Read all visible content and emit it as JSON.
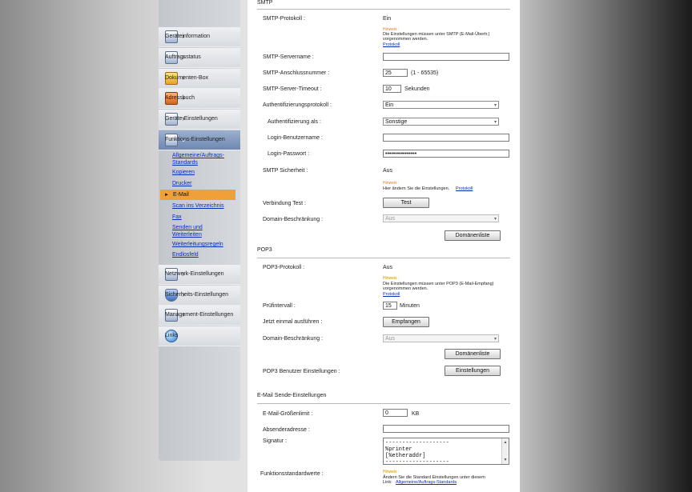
{
  "sidebar": {
    "items": [
      {
        "label": "Geräteinformation",
        "icon": "device-info-icon"
      },
      {
        "label": "Auftragsstatus",
        "icon": "job-status-icon"
      },
      {
        "label": "Dokumenten-Box",
        "icon": "document-box-icon"
      },
      {
        "label": "Adressbuch",
        "icon": "address-book-icon"
      },
      {
        "label": "Geräte-Einstellungen",
        "icon": "device-settings-icon"
      },
      {
        "label": "Funktions-Einstellungen",
        "icon": "function-settings-icon"
      },
      {
        "label": "Netzwerk-Einstellungen",
        "icon": "network-settings-icon"
      },
      {
        "label": "Sicherheits-Einstellungen",
        "icon": "shield-icon"
      },
      {
        "label": "Management-Einstellungen",
        "icon": "management-settings-icon"
      },
      {
        "label": "Links",
        "icon": "globe-icon"
      }
    ],
    "submenu": [
      "Allgemeine/Auftrags-Standards",
      "Kopieren",
      "Drucker",
      "E-Mail",
      "Scan ins Verzeichnis",
      "Fax",
      "Senden und Weiterleiten",
      "Weiterleitungsregeln",
      "Endlosfeld"
    ]
  },
  "smtp": {
    "title": "SMTP",
    "protocol_label": "SMTP-Protokoll :",
    "protocol_value": "Ein",
    "hint_title": "Hinweis :",
    "hint_text": "Die Einstellungen müssen unter SMTP (E-Mail-Übertr.) vorgenommen werden.",
    "hint_link": "Protokoll",
    "server_label": "SMTP-Servername :",
    "server_value": "",
    "port_label": "SMTP-Anschlussnummer :",
    "port_value": "25",
    "port_range": "(1 - 65535)",
    "timeout_label": "SMTP-Server-Timeout :",
    "timeout_value": "10",
    "timeout_unit": "Sekunden",
    "auth_protocol_label": "Authentifizierungsprotokoll :",
    "auth_protocol_value": "Ein",
    "auth_as_label": "Authentifizierung als :",
    "auth_as_value": "Sonstige",
    "login_user_label": "Login-Benutzername :",
    "login_user_value": "",
    "login_pass_label": "Login-Passwort :",
    "login_pass_value": "••••••••••••••••",
    "security_label": "SMTP Sicherheit :",
    "security_value": "Aus",
    "security_hint_title": "Hinweis :",
    "security_hint_text": "Hier ändern Sie die Einstellungen.",
    "security_hint_link": "Protokoll",
    "test_label": "Verbindung Test :",
    "test_button": "Test",
    "domain_label": "Domain-Beschränkung :",
    "domain_value": "Aus",
    "domain_list_button": "Domänenliste"
  },
  "pop3": {
    "title": "POP3",
    "protocol_label": "POP3-Protokoll :",
    "protocol_value": "Aus",
    "hint_title": "Hinweis :",
    "hint_text": "Die Einstellungen müssen unter POP3 (E-Mail-Empfang) vorgenommen werden.",
    "hint_link": "Protokoll",
    "interval_label": "Prüfintervall :",
    "interval_value": "15",
    "interval_unit": "Minuten",
    "run_once_label": "Jetzt einmal ausführen :",
    "receive_button": "Empfangen",
    "domain_label": "Domain-Beschränkung :",
    "domain_value": "Aus",
    "domain_list_button": "Domänenliste",
    "user_settings_label": "POP3 Benutzer Einstellungen :",
    "user_settings_button": "Einstellungen"
  },
  "send": {
    "title": "E-Mail Sende-Einstellungen",
    "size_label": "E-Mail-Größenlimit :",
    "size_value": "0",
    "size_unit": "KB",
    "sender_label": "Absenderadresse :",
    "sender_value": "",
    "signature_label": "Signatur :",
    "signature_value": "-------------------\n%printer\n[%etheraddr]\n-------------------",
    "defaults_label": "Funktionsstandardwerte :",
    "defaults_hint_title": "Hinweis :",
    "defaults_hint_text": "Ändern Sie die Standard Einstellungen unter diesem Link:",
    "defaults_hint_link": "Allgemeine/Auftrags-Standards"
  }
}
